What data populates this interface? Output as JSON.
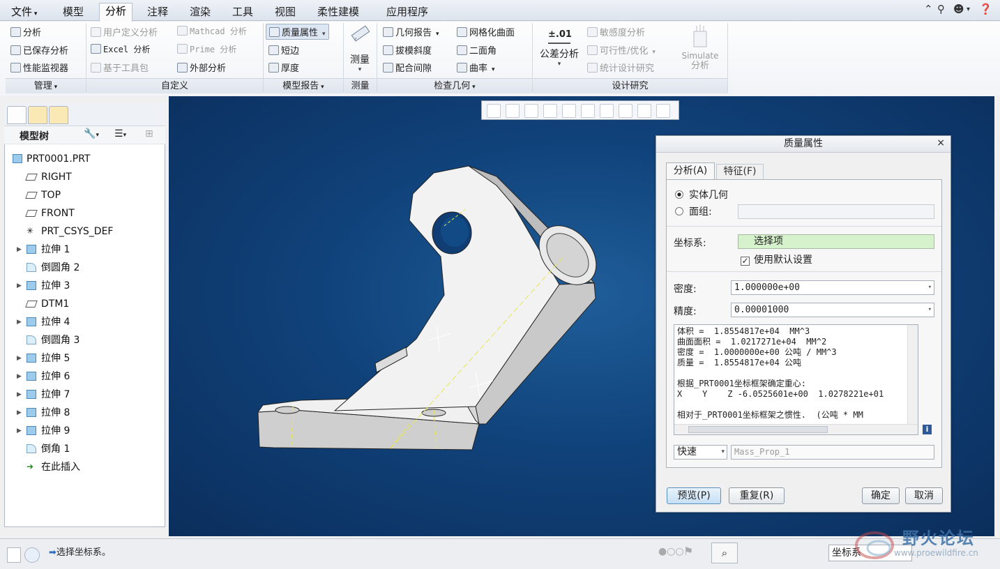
{
  "tabs": {
    "file": "文件",
    "items": [
      "模型",
      "分析",
      "注释",
      "渲染",
      "工具",
      "视图",
      "柔性建模",
      "应用程序"
    ],
    "active": "分析"
  },
  "ribbon": {
    "manage": {
      "analysis": "分析",
      "saved": "已保存分析",
      "perf": "性能监视器",
      "group": "管理"
    },
    "custom": {
      "udf": "用户定义分析",
      "mathcad": "Mathcad 分析",
      "excel": "Excel 分析",
      "prime": "Prime 分析",
      "toolkit": "基于工具包",
      "external": "外部分析",
      "group": "自定义"
    },
    "model_report": {
      "mass_props": "质量属性",
      "short_edge": "短边",
      "thickness": "厚度",
      "group": "模型报告"
    },
    "measure": {
      "label": "测量",
      "group": "测量"
    },
    "inspect": {
      "geom_report": "几何报告",
      "mesh": "网格化曲面",
      "draft": "拔模斜度",
      "dihedral": "二面角",
      "clearance": "配合间隙",
      "curvature": "曲率",
      "group": "检查几何"
    },
    "design": {
      "tolerance": "公差分析",
      "tolerance_icon": "±.01",
      "sensitivity": "敏感度分析",
      "feasibility": "可行性/优化",
      "stat": "统计设计研究",
      "simulate1": "Simulate",
      "simulate2": "分析",
      "group": "设计研究"
    }
  },
  "tree": {
    "title": "模型树",
    "root": "PRT0001.PRT",
    "items": [
      "RIGHT",
      "TOP",
      "FRONT",
      "PRT_CSYS_DEF",
      "拉伸 1",
      "倒圆角 2",
      "拉伸 3",
      "DTM1",
      "拉伸 4",
      "倒圆角 3",
      "拉伸 5",
      "拉伸 6",
      "拉伸 7",
      "拉伸 8",
      "拉伸 9",
      "倒角 1",
      "在此插入"
    ]
  },
  "dialog": {
    "title": "质量属性",
    "tab_analysis": "分析(A)",
    "tab_feature": "特征(F)",
    "solid": "实体几何",
    "quilt": "面组:",
    "csys_label": "坐标系:",
    "csys_value": "选择项",
    "use_default": "使用默认设置",
    "density_label": "密度:",
    "density_value": "1.000000e+00",
    "accuracy_label": "精度:",
    "accuracy_value": "0.00001000",
    "results": [
      "体积 =  1.8554817e+04  MM^3",
      "曲面面积 =  1.0217271e+04  MM^2",
      "密度 =  1.0000000e+00 公吨 / MM^3",
      "质量 =  1.8554817e+04 公吨",
      "",
      "根据_PRT0001坐标框架确定重心:",
      "X    Y    Z -6.0525601e+00  1.0278221e+01",
      "",
      "相对于_PRT0001坐标框架之惯性.  (公吨 * MM"
    ],
    "mode": "快速",
    "name": "Mass_Prop_1",
    "preview": "预览(P)",
    "repeat": "重复(R)",
    "ok": "确定",
    "cancel": "取消"
  },
  "status": {
    "message": "选择坐标系。",
    "filter": "坐标系",
    "watermark": "野火论坛",
    "watermark_url": "www.proewildfire.cn"
  }
}
